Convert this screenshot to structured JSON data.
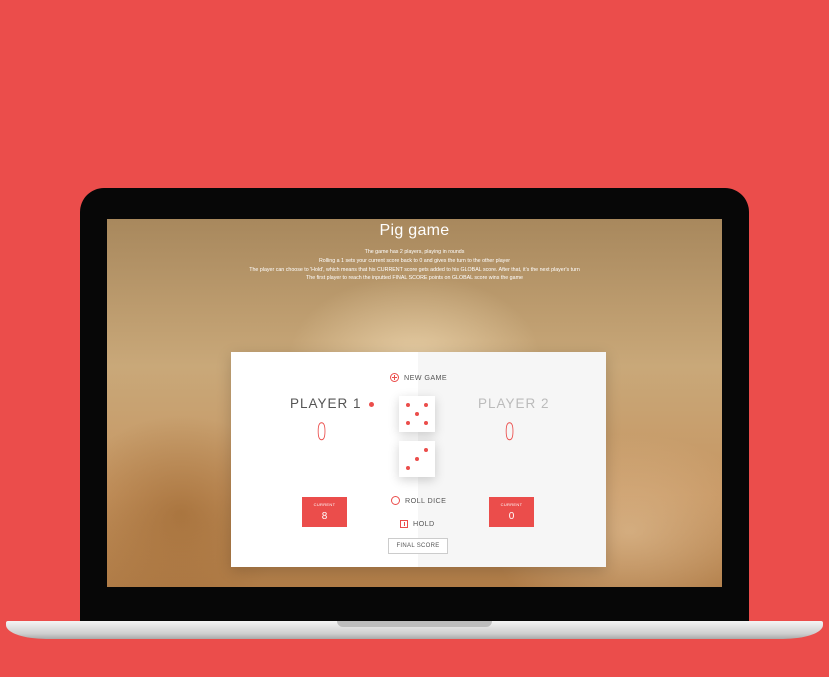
{
  "game": {
    "title": "Pig game",
    "rules": [
      "The game has 2 players, playing in rounds",
      "Rolling a 1 sets your current score back to 0 and gives the turn to the other player",
      "The player can choose to 'Hold', which means that his CURRENT score gets added to his GLOBAL score. After that, it's the next player's turn",
      "The first player to reach the inputted FINAL SCORE points on GLOBAL score wins the game"
    ]
  },
  "actions": {
    "new_game": "NEW GAME",
    "roll_dice": "ROLL DICE",
    "hold": "HOLD",
    "final_score": "FINAL SCORE"
  },
  "players": [
    {
      "name": "PLAYER 1",
      "score": "0",
      "current_label": "CURRENT",
      "current_value": "8",
      "active": true
    },
    {
      "name": "PLAYER 2",
      "score": "0",
      "current_label": "CURRENT",
      "current_value": "0",
      "active": false
    }
  ],
  "dice": [
    5,
    3
  ],
  "colors": {
    "accent": "#EB4D4B",
    "background": "#EB4D4B"
  },
  "icons": {
    "new_game": "plus-circle-icon",
    "roll_dice": "refresh-circle-icon",
    "hold": "download-icon"
  }
}
